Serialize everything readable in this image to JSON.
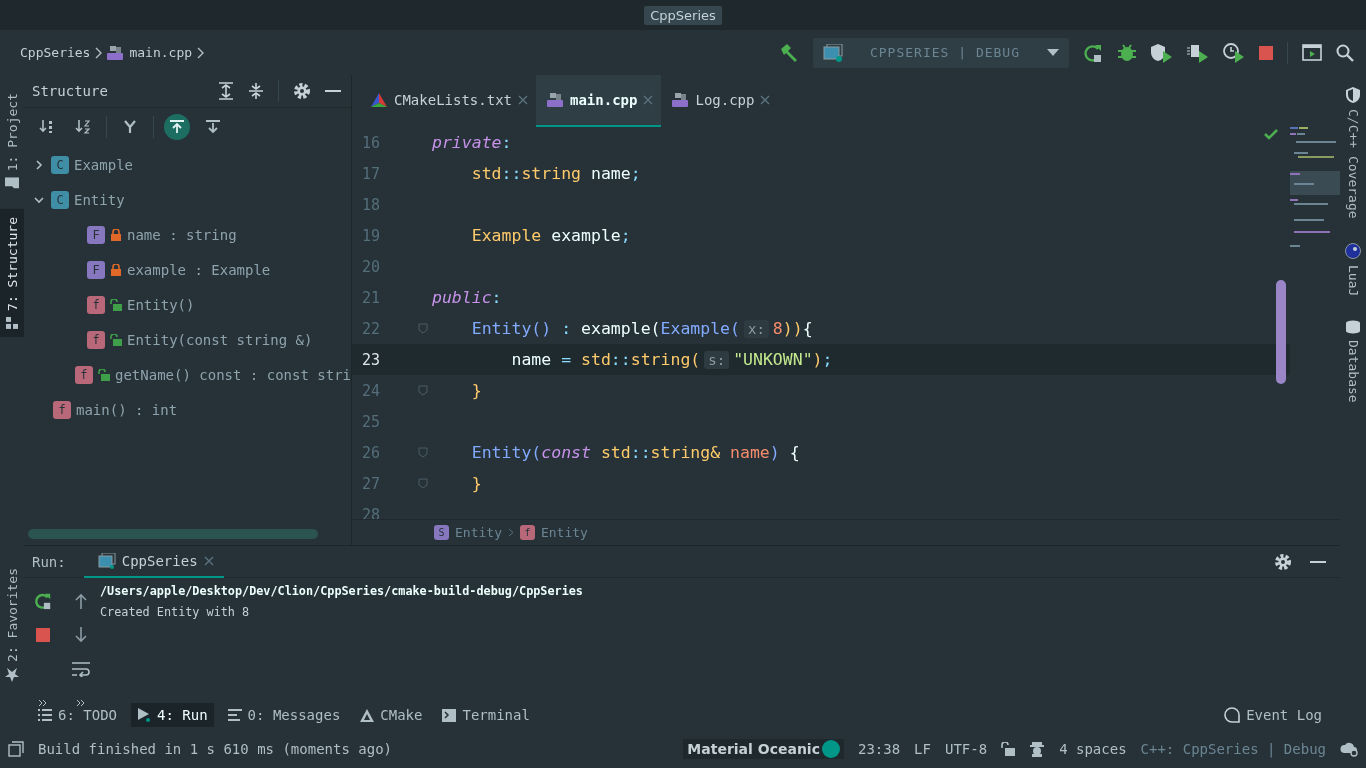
{
  "window": {
    "title": "CppSeries"
  },
  "breadcrumb": [
    {
      "label": "CppSeries",
      "kind": "project"
    },
    {
      "label": "main.cpp",
      "kind": "cpp"
    }
  ],
  "run_config": {
    "label": "CPPSERIES | DEBUG"
  },
  "left_stripe_top": [
    {
      "label": "1: Project",
      "kind": "project",
      "selected": false
    },
    {
      "label": "7: Structure",
      "kind": "structure",
      "selected": true
    }
  ],
  "left_stripe_bottom": [
    {
      "label": "2: Favorites",
      "kind": "favorites",
      "selected": false
    }
  ],
  "structure": {
    "title": "Structure",
    "toolbar": [
      {
        "kind": "sort-visibility",
        "selected": false
      },
      {
        "kind": "sort-alpha",
        "selected": false
      },
      {
        "kind": "group",
        "selected": false
      },
      {
        "kind": "autoscroll-to",
        "selected": true
      },
      {
        "kind": "autoscroll-from",
        "selected": false
      }
    ],
    "tree": [
      {
        "label": "Example",
        "kind": "class",
        "badge": "C",
        "expanded": false
      },
      {
        "label": "Entity",
        "kind": "class",
        "badge": "C",
        "expanded": true,
        "children": [
          {
            "label": "name : string",
            "kind": "field",
            "badge": "F",
            "locked": true
          },
          {
            "label": "example : Example",
            "kind": "field",
            "badge": "F",
            "locked": true
          },
          {
            "label": "Entity()",
            "kind": "function",
            "badge": "f",
            "locked": false
          },
          {
            "label": "Entity(const string &)",
            "kind": "function",
            "badge": "f",
            "locked": false
          },
          {
            "label": "getName() const : const stri",
            "kind": "function",
            "badge": "f",
            "locked": false
          }
        ]
      },
      {
        "label": "main() : int",
        "kind": "function",
        "badge": "f"
      }
    ]
  },
  "editor": {
    "tabs": [
      {
        "label": "CMakeLists.txt",
        "kind": "cmake",
        "selected": false
      },
      {
        "label": "main.cpp",
        "kind": "cpp",
        "selected": true
      },
      {
        "label": "Log.cpp",
        "kind": "cpp",
        "selected": false
      }
    ],
    "lines": [
      {
        "number": "16",
        "tokens": [
          {
            "kind": "kw",
            "text": "private"
          },
          {
            "kind": "punct",
            "text": ":"
          }
        ]
      },
      {
        "number": "17",
        "tokens": [
          {
            "kind": "type",
            "text": "    std"
          },
          {
            "kind": "punct",
            "text": "::"
          },
          {
            "kind": "type",
            "text": "string"
          },
          {
            "kind": "plain",
            "text": " name"
          },
          {
            "kind": "punct",
            "text": ";"
          }
        ]
      },
      {
        "number": "18"
      },
      {
        "number": "19",
        "tokens": [
          {
            "kind": "type",
            "text": "    Example"
          },
          {
            "kind": "plain",
            "text": " example"
          },
          {
            "kind": "punct",
            "text": ";"
          }
        ]
      },
      {
        "number": "20"
      },
      {
        "number": "21",
        "tokens": [
          {
            "kind": "kw",
            "text": "public"
          },
          {
            "kind": "punct",
            "text": ":"
          }
        ]
      },
      {
        "number": "22",
        "fold": true,
        "tokens": [
          {
            "kind": "fn",
            "text": "    Entity()"
          },
          {
            "kind": "punct",
            "text": " : "
          },
          {
            "kind": "plain",
            "text": "example("
          },
          {
            "kind": "fn",
            "text": "Example("
          },
          {
            "kind": "hint",
            "text": "x:"
          },
          {
            "kind": "num",
            "text": "8"
          },
          {
            "kind": "brace",
            "text": "))"
          },
          {
            "kind": "plain",
            "text": "{"
          }
        ]
      },
      {
        "number": "23",
        "current": true,
        "tokens": [
          {
            "kind": "plain",
            "text": "        name"
          },
          {
            "kind": "punct",
            "text": " = "
          },
          {
            "kind": "type",
            "text": "std"
          },
          {
            "kind": "punct",
            "text": "::"
          },
          {
            "kind": "type",
            "text": "string("
          },
          {
            "kind": "hint",
            "text": "s:"
          },
          {
            "kind": "str",
            "text": "\"UNKOWN\""
          },
          {
            "kind": "brace",
            "text": ")"
          },
          {
            "kind": "punct",
            "text": ";"
          }
        ]
      },
      {
        "number": "24",
        "fold": true,
        "tokens": [
          {
            "kind": "brace",
            "text": "    }"
          }
        ]
      },
      {
        "number": "25"
      },
      {
        "number": "26",
        "fold": true,
        "tokens": [
          {
            "kind": "fn",
            "text": "    Entity("
          },
          {
            "kind": "kw",
            "text": "const"
          },
          {
            "kind": "type",
            "text": " std"
          },
          {
            "kind": "punct",
            "text": "::"
          },
          {
            "kind": "type",
            "text": "string&"
          },
          {
            "kind": "param",
            "text": " name"
          },
          {
            "kind": "fn",
            "text": ")"
          },
          {
            "kind": "plain",
            "text": " {"
          }
        ]
      },
      {
        "number": "27",
        "fold": true,
        "tokens": [
          {
            "kind": "brace",
            "text": "    }"
          }
        ]
      },
      {
        "number": "28"
      }
    ],
    "breadcrumb": [
      {
        "label": "Entity",
        "kind": "struct",
        "badge": "S"
      },
      {
        "label": "Entity",
        "kind": "function",
        "badge": "f"
      }
    ]
  },
  "right_stripe": [
    {
      "label": "C/C++ Coverage",
      "kind": "coverage"
    },
    {
      "label": "LuaJ",
      "kind": "lua"
    },
    {
      "label": "Database",
      "kind": "database"
    }
  ],
  "run_panel": {
    "label": "Run:",
    "tabs": [
      {
        "label": "CppSeries",
        "selected": true
      }
    ],
    "output": [
      {
        "text": "/Users/apple/Desktop/Dev/Clion/CppSeries/cmake-build-debug/CppSeries",
        "kind": "command"
      },
      {
        "text": "Created Entity with 8",
        "kind": "stdout"
      }
    ]
  },
  "bottom_tabs": [
    {
      "label": "6: TODO",
      "kind": "todo",
      "selected": false
    },
    {
      "label": "4: Run",
      "kind": "run",
      "selected": true
    },
    {
      "label": "0: Messages",
      "kind": "messages",
      "selected": false
    },
    {
      "label": "CMake",
      "kind": "cmake",
      "selected": false
    },
    {
      "label": "Terminal",
      "kind": "terminal",
      "selected": false
    }
  ],
  "event_log": "Event Log",
  "status_bar": {
    "message": "Build finished in 1 s 610 ms (moments ago)",
    "theme": "Material Oceanic",
    "position": "23:38",
    "line_separator": "LF",
    "encoding": "UTF-8",
    "indent": "4 spaces",
    "context": "C++: CppSeries | Debug"
  }
}
